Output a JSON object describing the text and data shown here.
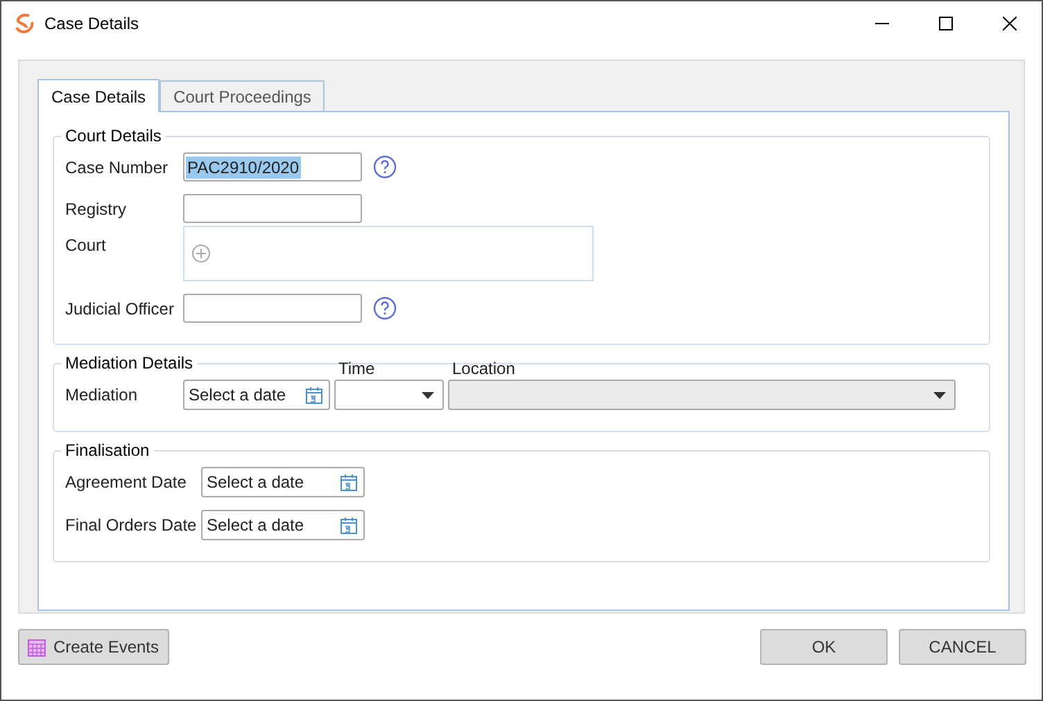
{
  "window": {
    "title": "Case Details"
  },
  "tabs": [
    {
      "label": "Case Details",
      "selected": true
    },
    {
      "label": "Court Proceedings",
      "selected": false
    }
  ],
  "sections": [
    {
      "title": "Court Details",
      "fields": [
        {
          "kind": "text",
          "label": "Case Number",
          "value": "PAC2910/2020",
          "highlighted": true,
          "help": true
        },
        {
          "kind": "text",
          "label": "Registry",
          "help": false
        },
        {
          "kind": "list",
          "label": "Court"
        },
        {
          "kind": "text",
          "label": "Judicial Officer",
          "help": true
        }
      ]
    },
    {
      "title": "Mediation Details",
      "fields": [
        {
          "kind": "mediation",
          "label": "Mediation",
          "placeholder": "Select a date",
          "time_label": "Time",
          "location_label": "Location",
          "location_disabled": true
        }
      ]
    },
    {
      "title": "Finalisation",
      "fields": [
        {
          "kind": "date",
          "label": "Agreement Date",
          "placeholder": "Select a date"
        },
        {
          "kind": "date",
          "label": "Final Orders Date",
          "placeholder": "Select a date"
        }
      ]
    }
  ],
  "buttons": {
    "create": "Create Events",
    "ok": "OK",
    "cancel": "CANCEL"
  }
}
